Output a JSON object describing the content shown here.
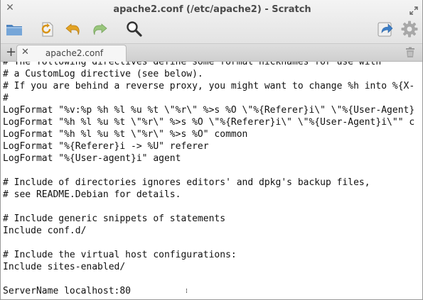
{
  "window": {
    "title": "apache2.conf (/etc/apache2) - Scratch"
  },
  "toolbar": {
    "buttons": [
      {
        "name": "open-folder",
        "icon": "folder-icon"
      },
      {
        "name": "revert",
        "icon": "revert-icon"
      },
      {
        "name": "undo",
        "icon": "undo-icon"
      },
      {
        "name": "redo",
        "icon": "redo-icon"
      },
      {
        "name": "search",
        "icon": "search-icon"
      },
      {
        "name": "share",
        "icon": "share-icon"
      },
      {
        "name": "settings",
        "icon": "gear-icon"
      }
    ]
  },
  "tabs": {
    "new_tab_label": "+",
    "close_glyph": "✕",
    "items": [
      {
        "label": "apache2.conf"
      }
    ]
  },
  "editor": {
    "lines": [
      "# The following directives define some format nicknames for use with",
      "# a CustomLog directive (see below).",
      "# If you are behind a reverse proxy, you might want to change %h into %{X-",
      "#",
      "LogFormat \"%v:%p %h %l %u %t \\\"%r\\\" %>s %O \\\"%{Referer}i\\\" \\\"%{User-Agent}",
      "LogFormat \"%h %l %u %t \\\"%r\\\" %>s %O \\\"%{Referer}i\\\" \\\"%{User-Agent}i\\\"\" c",
      "LogFormat \"%h %l %u %t \\\"%r\\\" %>s %O\" common",
      "LogFormat \"%{Referer}i -> %U\" referer",
      "LogFormat \"%{User-agent}i\" agent",
      "",
      "# Include of directories ignores editors' and dpkg's backup files,",
      "# see README.Debian for details.",
      "",
      "# Include generic snippets of statements",
      "Include conf.d/",
      "",
      "# Include the virtual host configurations:",
      "Include sites-enabled/",
      "",
      "ServerName localhost:80"
    ]
  },
  "colors": {
    "accent_blue": "#3d7fc8",
    "folder_blue": "#5f93c8",
    "arrow_yellow": "#e0a020",
    "arrow_green": "#7fb85a"
  }
}
